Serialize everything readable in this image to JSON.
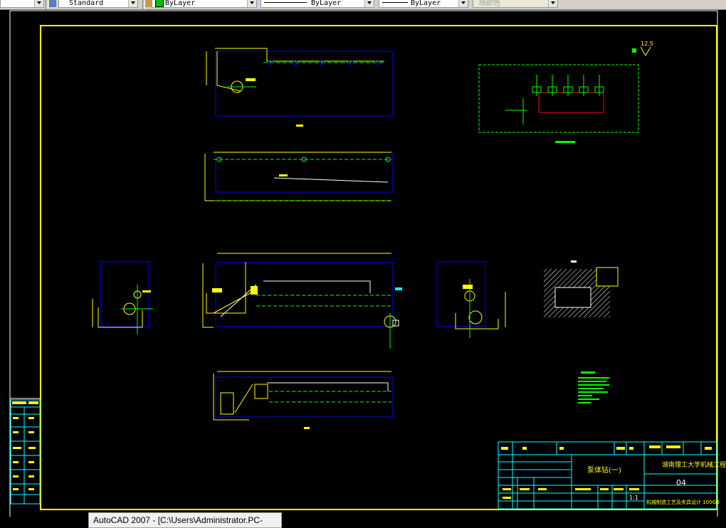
{
  "toolbar": {
    "text_style_value": "Standard",
    "color_value": "ByLayer",
    "linetype_value": "ByLayer",
    "lineweight_value": "ByLayer",
    "plotstyle_value": "随颜色"
  },
  "drawing": {
    "roughness_symbol": "12.5",
    "title_block": {
      "drawing_name": "泵体钻(一)",
      "school": "湖南理工大学机械工程学院",
      "drawing_number": "04",
      "scale": "1:1",
      "note": "机械制造工艺及夹具设计 100GB"
    }
  },
  "taskbar": {
    "window_title": "AutoCAD 2007 - [C:\\Users\\Administrator.PC-"
  }
}
